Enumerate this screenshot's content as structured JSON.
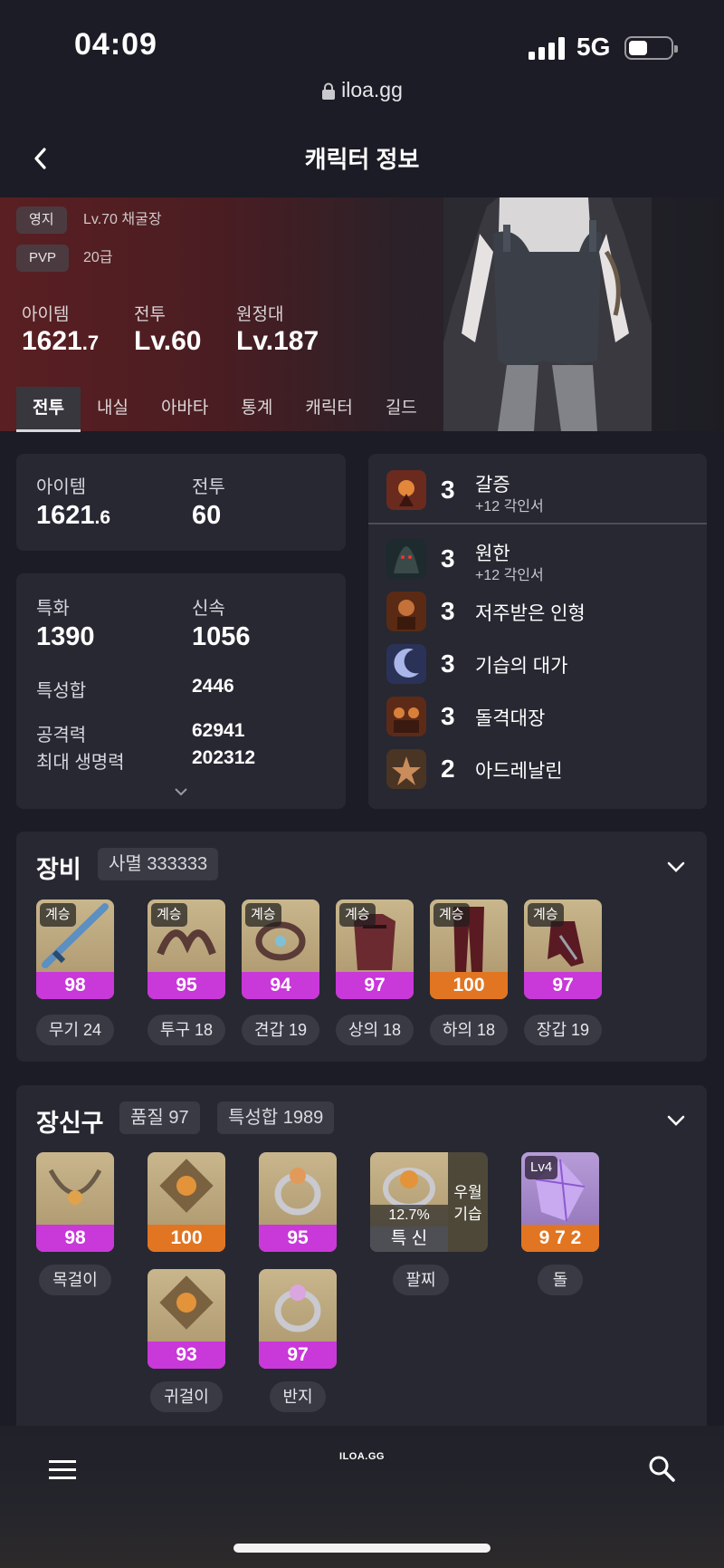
{
  "status_bar": {
    "time": "04:09",
    "network": "5G"
  },
  "browser": {
    "url": "iloa.gg"
  },
  "header": {
    "title": "캐릭터 정보"
  },
  "hero": {
    "territory_label": "영지",
    "territory_value": "Lv.70 채굴장",
    "pvp_label": "PVP",
    "pvp_value": "20급",
    "item_label": "아이템",
    "item_value_int": "1621",
    "item_value_dec": ".7",
    "combat_label": "전투",
    "combat_value": "Lv.60",
    "expedition_label": "원정대",
    "expedition_value": "Lv.187"
  },
  "tabs": [
    "전투",
    "내실",
    "아바타",
    "통계",
    "캐릭터",
    "길드"
  ],
  "summary": {
    "item_label": "아이템",
    "item_int": "1621",
    "item_dec": ".6",
    "combat_label": "전투",
    "combat_value": "60"
  },
  "stats": {
    "crit_label": "특화",
    "crit_value": "1390",
    "swift_label": "신속",
    "swift_value": "1056",
    "total_label": "특성합",
    "total_value": "2446",
    "atk_label": "공격력",
    "atk_value": "62941",
    "hp_label": "최대 생명력",
    "hp_value": "202312"
  },
  "engravings": [
    {
      "level": "3",
      "name": "갈증",
      "sub": "+12 각인서"
    },
    {
      "level": "3",
      "name": "원한",
      "sub": "+12 각인서"
    },
    {
      "level": "3",
      "name": "저주받은 인형",
      "sub": ""
    },
    {
      "level": "3",
      "name": "기습의 대가",
      "sub": ""
    },
    {
      "level": "3",
      "name": "돌격대장",
      "sub": ""
    },
    {
      "level": "2",
      "name": "아드레날린",
      "sub": ""
    }
  ],
  "equipment": {
    "title": "장비",
    "set_chip": "사멸 333333",
    "items": [
      {
        "tag": "계승",
        "quality": "98",
        "slot": "무기 24"
      },
      {
        "tag": "계승",
        "quality": "95",
        "slot": "투구 18"
      },
      {
        "tag": "계승",
        "quality": "94",
        "slot": "견갑 19"
      },
      {
        "tag": "계승",
        "quality": "97",
        "slot": "상의 18"
      },
      {
        "tag": "계승",
        "quality": "100",
        "slot": "하의 18"
      },
      {
        "tag": "계승",
        "quality": "97",
        "slot": "장갑 19"
      }
    ]
  },
  "accessories": {
    "title": "장신구",
    "quality_chip": "품질 97",
    "total_chip": "특성합 1989",
    "necklace": {
      "quality": "98",
      "label": "목걸이"
    },
    "earring1": {
      "quality": "100"
    },
    "ring1": {
      "quality": "95"
    },
    "earring2": {
      "quality": "93",
      "label": "귀걸이"
    },
    "ring2": {
      "quality": "97",
      "label": "반지"
    },
    "bracelet": {
      "percent": "12.7%",
      "stats": "특 신",
      "effect1": "우월",
      "effect2": "기습",
      "label": "팔찌"
    },
    "stone": {
      "level": "Lv4",
      "value": "9 7 2",
      "label": "돌"
    }
  },
  "bottom_nav": {
    "logo": "ILOA.GG"
  }
}
